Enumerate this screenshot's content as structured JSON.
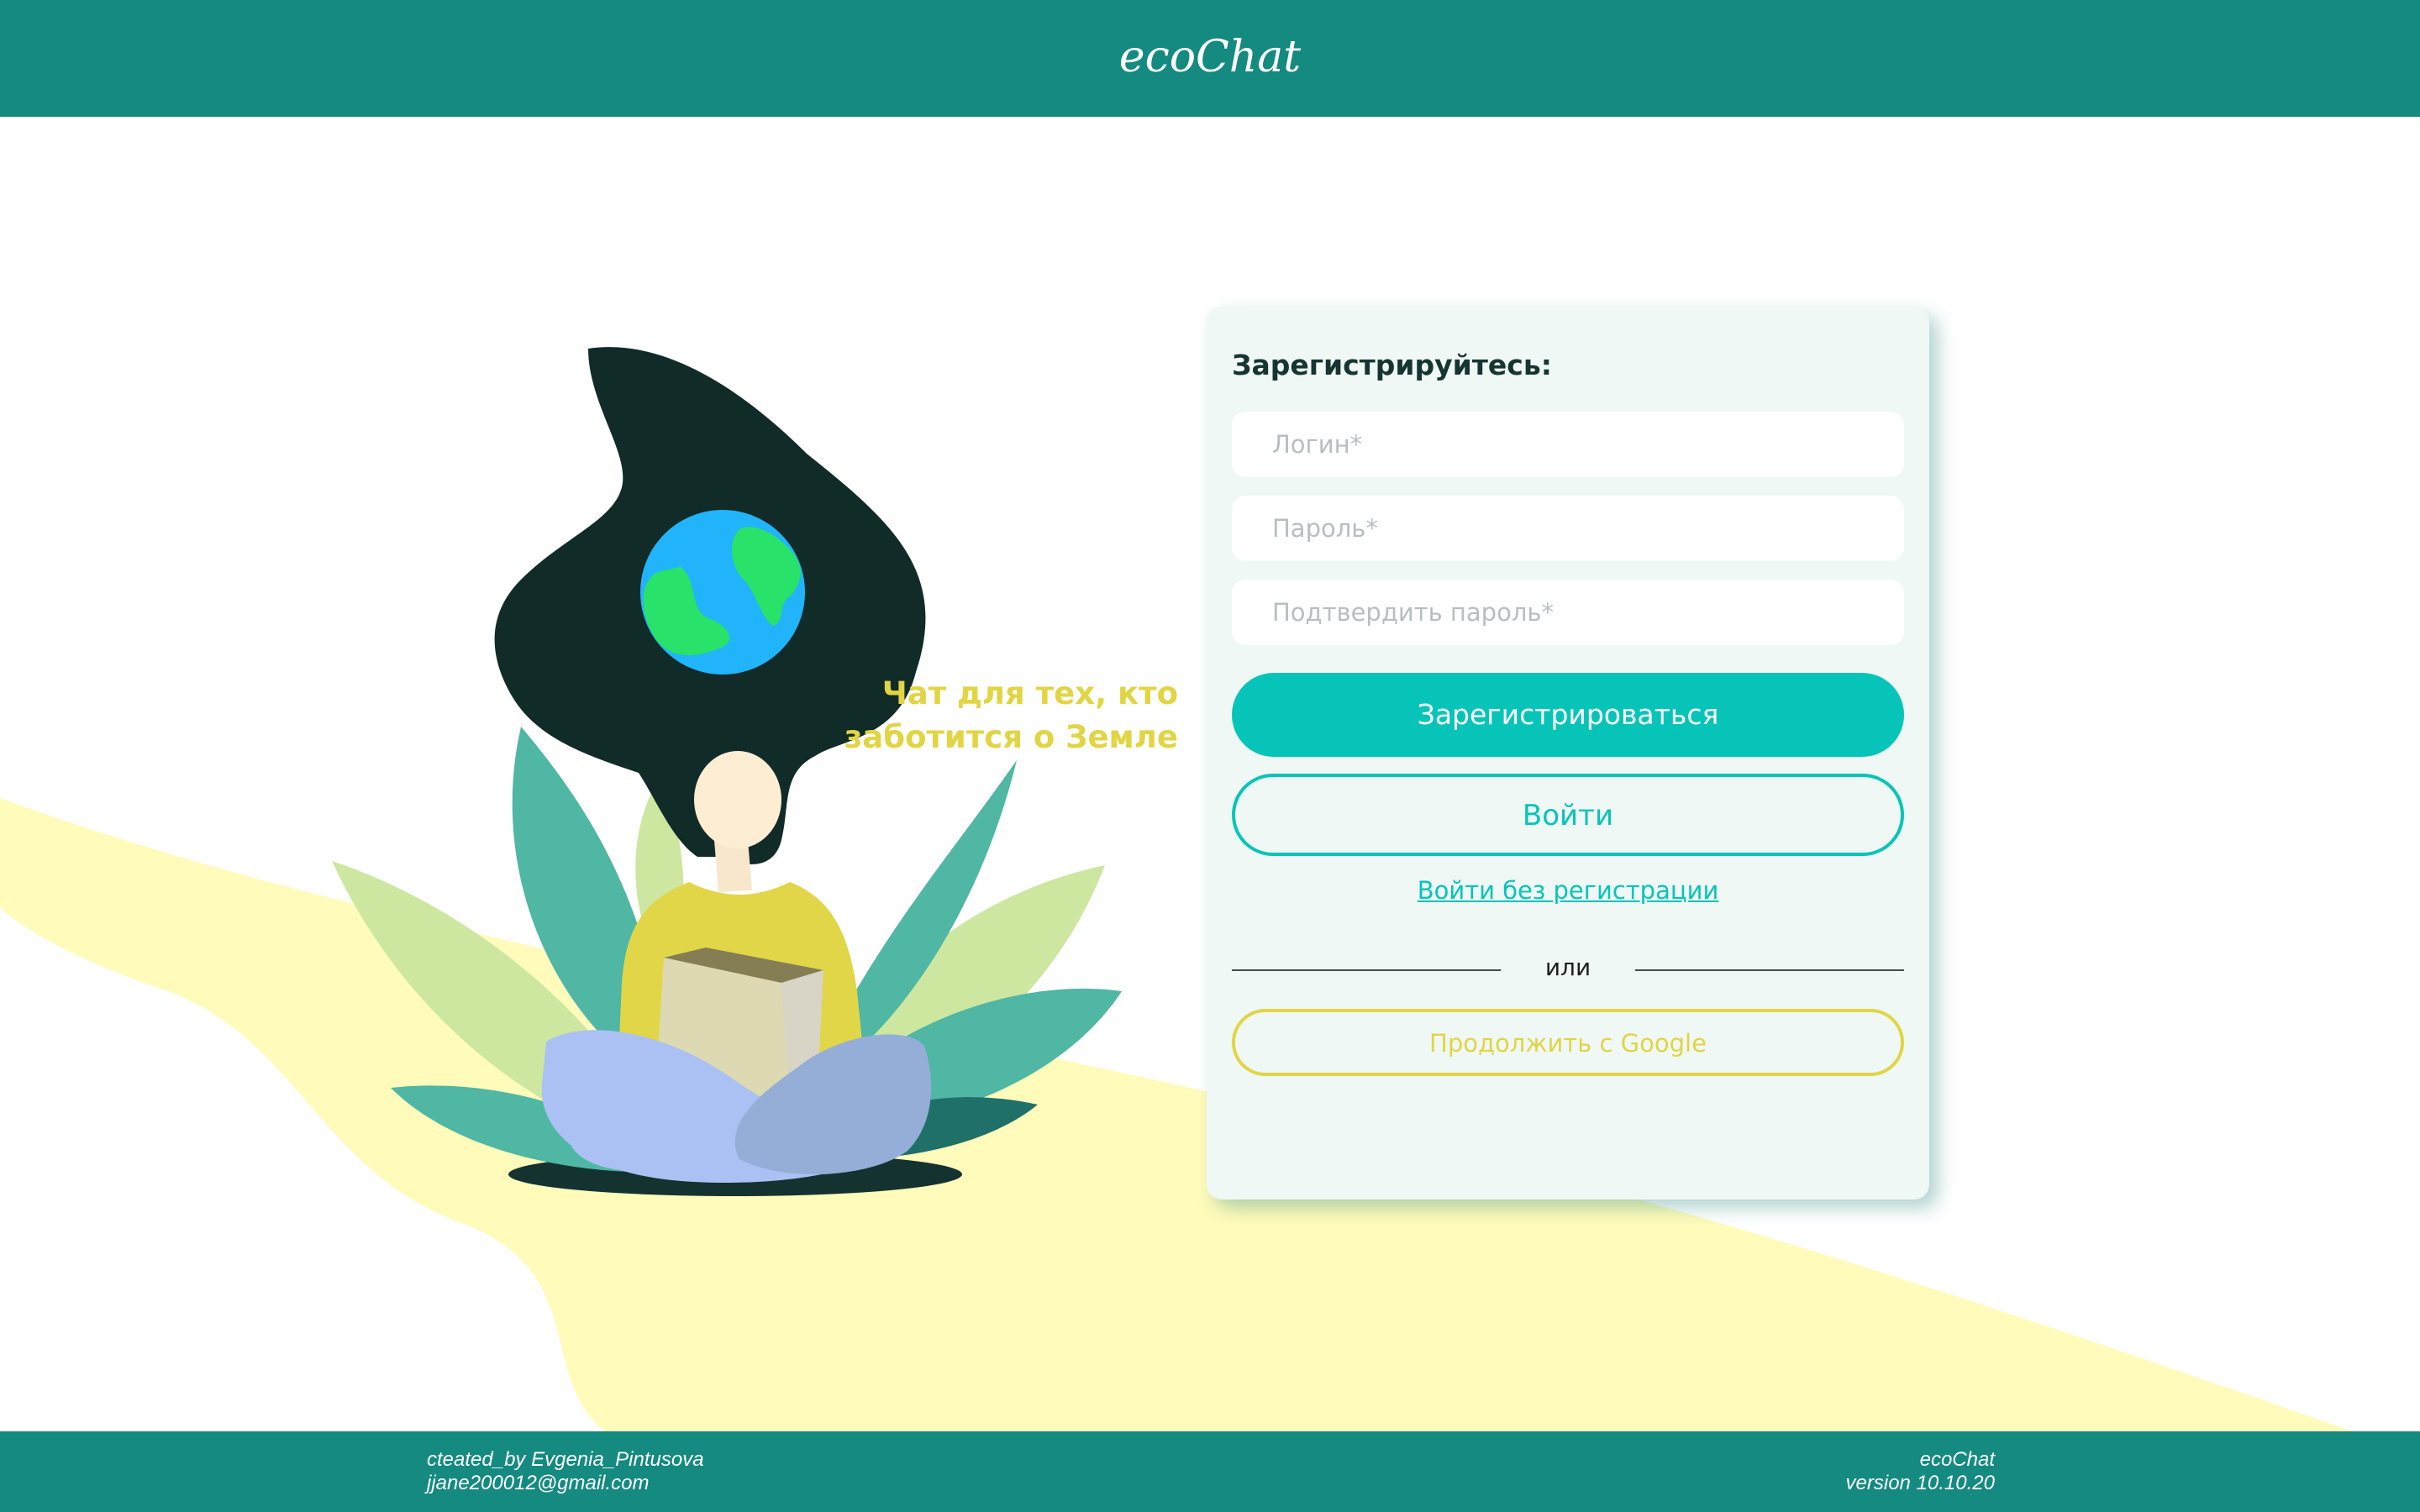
{
  "app": {
    "name": "ecoChat"
  },
  "hero": {
    "tagline_line1": "Чат для тех, кто",
    "tagline_line2": "заботится о Земле"
  },
  "form": {
    "title": "Зарегистрируйтесь:",
    "login_placeholder": "Логин*",
    "password_placeholder": "Пароль*",
    "confirm_placeholder": "Подтвердить пароль*",
    "register_label": "Зарегистрироваться",
    "login_label": "Войти",
    "guest_label": "Войти без регистрации",
    "divider_label": "или",
    "google_label": "Продолжить с Google"
  },
  "footer": {
    "created_by": "cteated_by Evgenia_Pintusova",
    "email": "jjane200012@gmail.com",
    "app_name": "ecoChat",
    "version": "version 10.10.20"
  },
  "icons": {
    "illustration": "woman-with-earth-illustration"
  },
  "colors": {
    "header": "#148a80",
    "accent": "#06c5b8",
    "yellow": "#e1d544",
    "card": "#eff8f5",
    "wave": "#fffbbb"
  }
}
